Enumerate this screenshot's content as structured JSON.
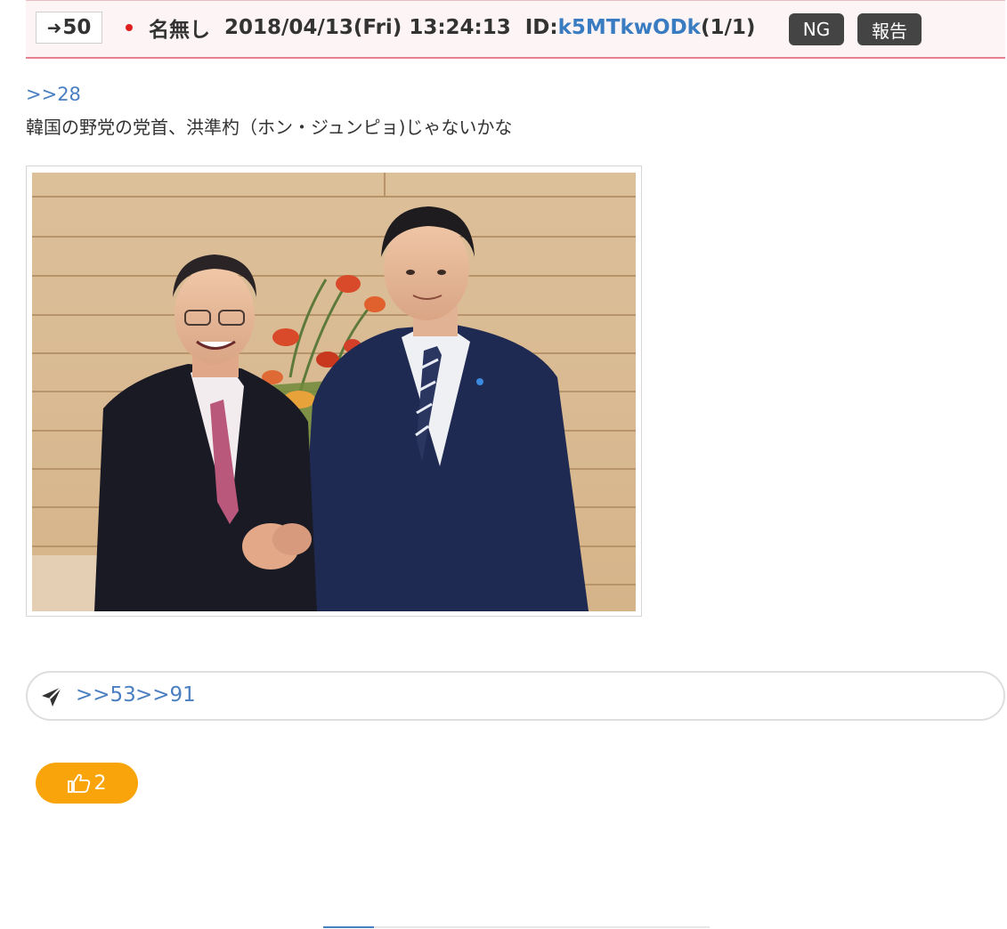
{
  "post": {
    "res_number": "50",
    "res_arrow_icon": "reply-arrow-icon",
    "name": "名無し",
    "datetime": "2018/04/13(Fri) 13:24:13",
    "id_prefix": "ID:",
    "id_value": "k5MTkwODk",
    "id_count": "(1/1)",
    "ng_label": "NG",
    "report_label": "報告",
    "anchor": ">>28",
    "body": "韓国の野党の党首、洪準杓（ホン・ジュンピョ)じゃないかな",
    "image_alt": "photo-two-men-handshake"
  },
  "replies": {
    "icon": "paper-plane-icon",
    "links": [
      ">>53",
      ">>91"
    ]
  },
  "like": {
    "icon": "thumbs-up-icon",
    "count": "2"
  },
  "colors": {
    "header_bg": "#fdf4f5",
    "header_border": "#e8818f",
    "link": "#3a7cc1",
    "tag_bg": "#444444",
    "like_bg": "#f9a40b"
  }
}
